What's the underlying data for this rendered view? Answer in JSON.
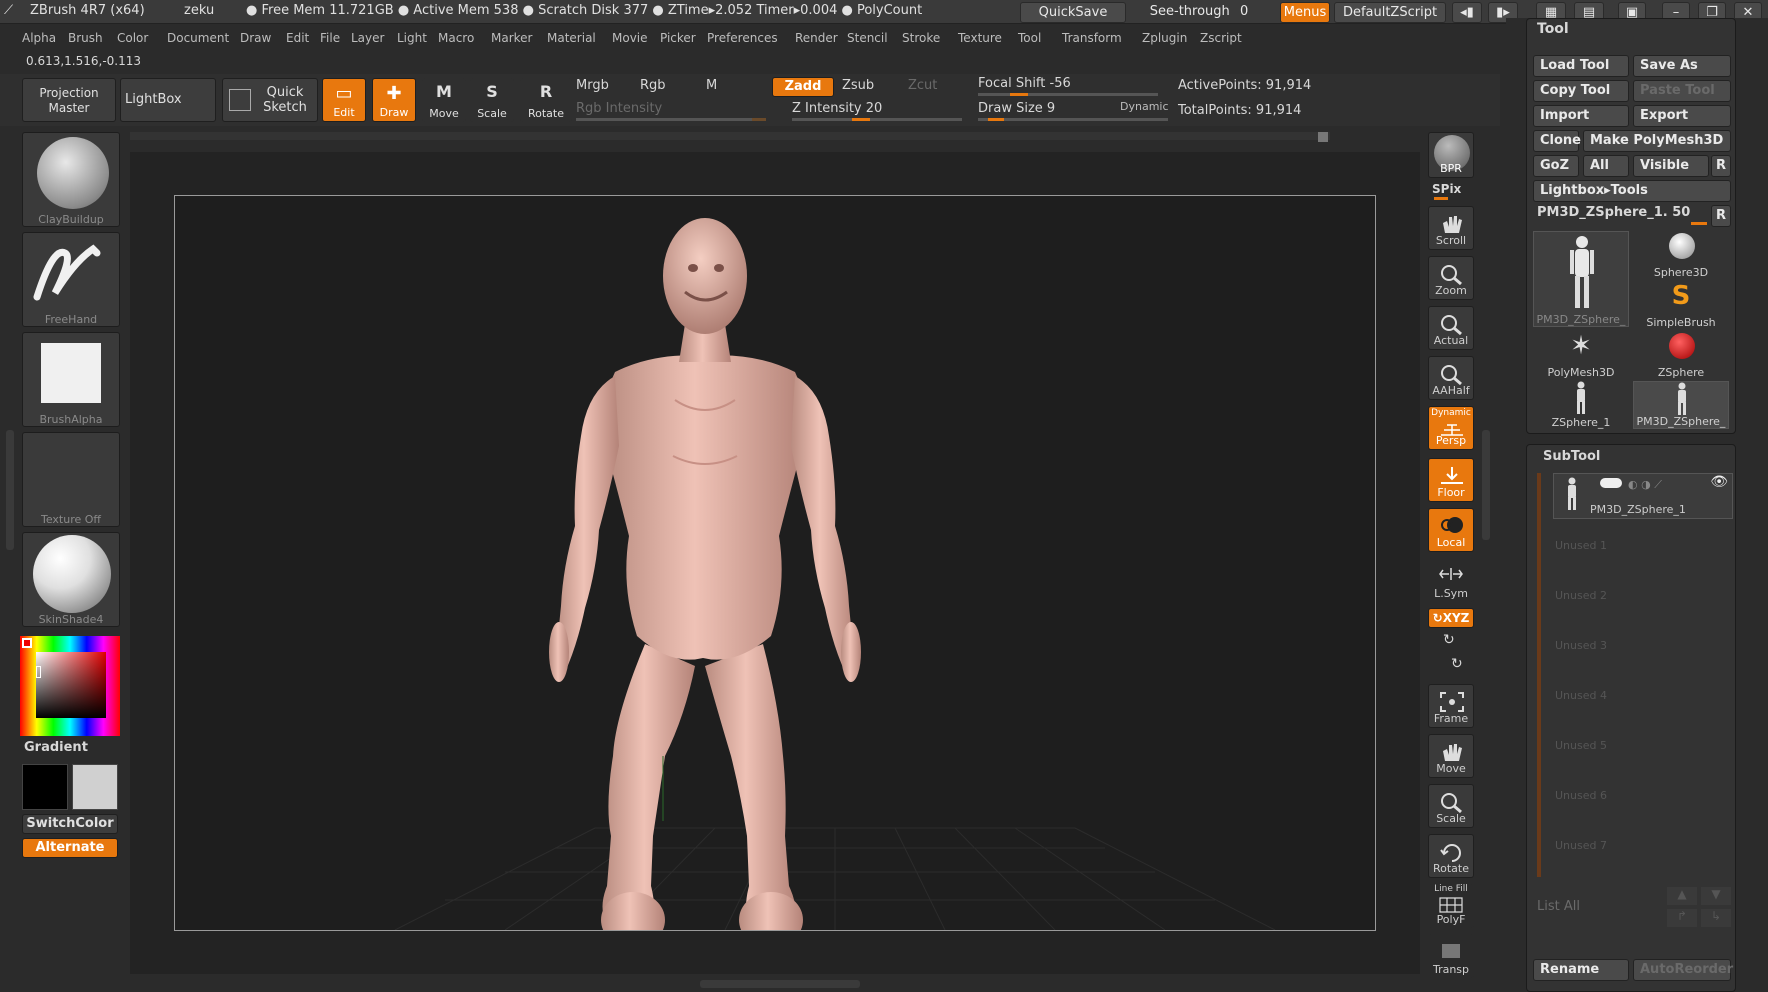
{
  "title": {
    "app": "ZBrush 4R7 (x64)",
    "user": "zeku",
    "stats": "● Free Mem 11.721GB ● Active Mem 538 ● Scratch Disk 377 ● ZTime▸2.052 Timer▸0.004 ● PolyCount"
  },
  "titlebar_buttons": {
    "quicksave": "QuickSave",
    "seethrough": "See-through",
    "seethrough_value": "0",
    "menus": "Menus",
    "script": "DefaultZScript"
  },
  "menu": [
    "Alpha",
    "Brush",
    "Color",
    "Document",
    "Draw",
    "Edit",
    "File",
    "Layer",
    "Light",
    "Macro",
    "Marker",
    "Material",
    "Movie",
    "Picker",
    "Preferences",
    "Render",
    "Stencil",
    "Stroke",
    "Texture",
    "Tool",
    "Transform",
    "Zplugin",
    "Zscript"
  ],
  "coords": "0.613,1.516,-0.113",
  "shelf": {
    "projection_master": "Projection Master",
    "lightbox": "LightBox",
    "quick_sketch": "Quick Sketch",
    "edit": "Edit",
    "draw": "Draw",
    "move": "Move",
    "scale": "Scale",
    "rotate": "Rotate",
    "mrgb": "Mrgb",
    "rgb": "Rgb",
    "m": "M",
    "zadd": "Zadd",
    "zsub": "Zsub",
    "zcut": "Zcut",
    "rgb_intensity": "Rgb Intensity",
    "z_intensity": "Z Intensity 20",
    "focal_shift": "Focal Shift -56",
    "draw_size": "Draw Size 9",
    "dynamic": "Dynamic",
    "active_points": "ActivePoints: 91,914",
    "total_points": "TotalPoints: 91,914"
  },
  "left": {
    "brush": "ClayBuildup",
    "stroke": "FreeHand",
    "alpha": "BrushAlpha",
    "texture": "Texture Off",
    "material": "SkinShade4",
    "gradient": "Gradient",
    "switchcolor": "SwitchColor",
    "alternate": "Alternate"
  },
  "dock": {
    "bpr": "BPR",
    "spix": "SPix",
    "scroll": "Scroll",
    "zoom": "Zoom",
    "actual": "Actual",
    "aahalf": "AAHalf",
    "dynamic": "Dynamic",
    "persp": "Persp",
    "floor": "Floor",
    "local": "Local",
    "lsym": "L.Sym",
    "xyz": "XYZ",
    "frame": "Frame",
    "move": "Move",
    "scale": "Scale",
    "rotate": "Rotate",
    "linefill": "Line Fill",
    "polyf": "PolyF",
    "transp": "Transp"
  },
  "tool": {
    "header": "Tool",
    "load": "Load Tool",
    "saveas": "Save As",
    "copy": "Copy Tool",
    "paste": "Paste Tool",
    "import": "Import",
    "export": "Export",
    "clone": "Clone",
    "make_polymesh": "Make PolyMesh3D",
    "goz": "GoZ",
    "all": "All",
    "visible": "Visible",
    "r": "R",
    "lightbox_tools": "Lightbox▸Tools",
    "current": "PM3D_ZSphere_1. 50",
    "items": [
      "PM3D_ZSphere_",
      "Sphere3D",
      "SimpleBrush",
      "PolyMesh3D",
      "ZSphere",
      "ZSphere_1",
      "PM3D_ZSphere_"
    ]
  },
  "subtool": {
    "header": "SubTool",
    "active": "PM3D_ZSphere_1",
    "unused": [
      "Unused 1",
      "Unused 2",
      "Unused 3",
      "Unused 4",
      "Unused 5",
      "Unused 6",
      "Unused 7"
    ],
    "list_all": "List All",
    "rename": "Rename",
    "autoreorder": "AutoReorder"
  },
  "colors": {
    "accent": "#e8780e",
    "panel": "#3a3a3a",
    "model": "#e7b5a8"
  }
}
